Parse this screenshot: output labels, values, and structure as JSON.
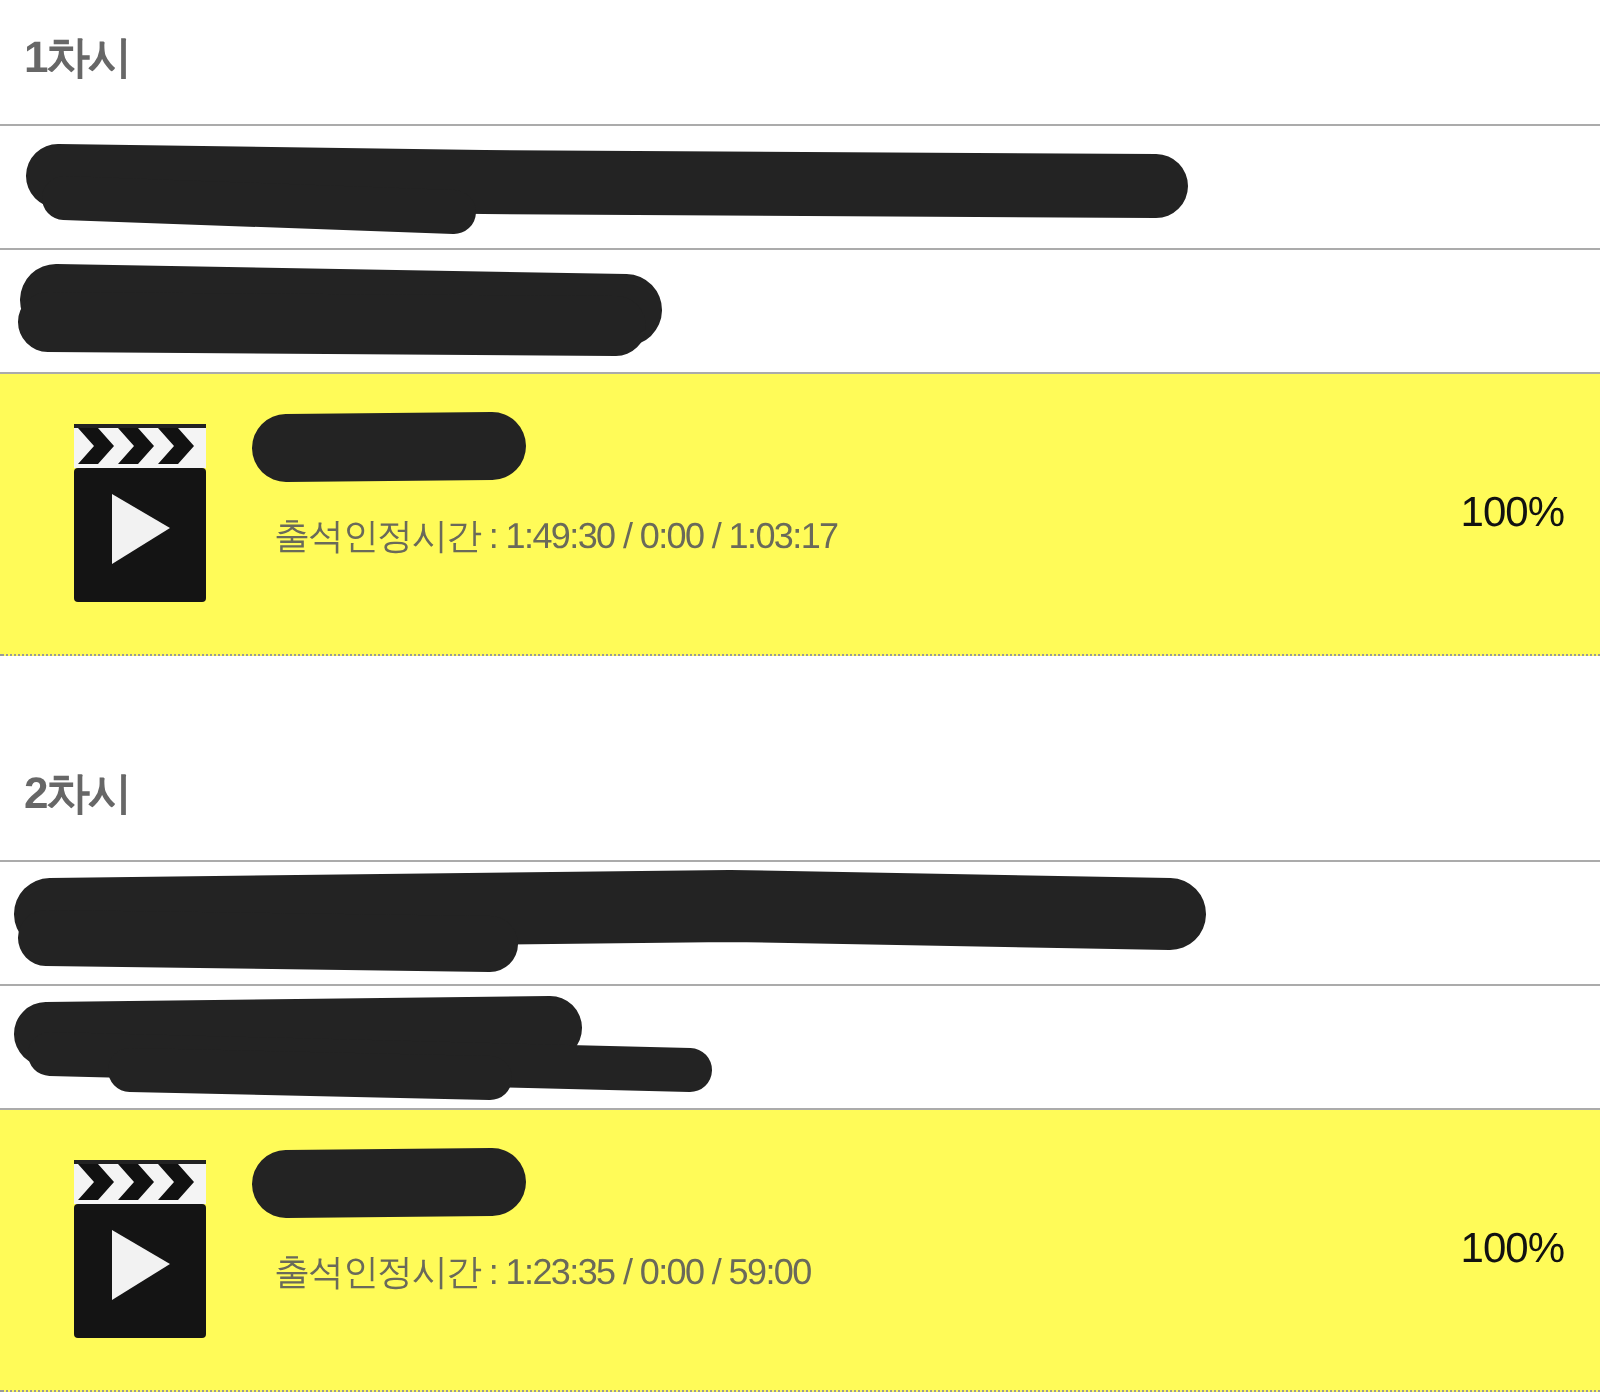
{
  "sessions": [
    {
      "title": "1차시",
      "rows": [
        {
          "kind": "redacted"
        },
        {
          "kind": "redacted"
        }
      ],
      "lecture": {
        "kind": "video",
        "highlighted": true,
        "title": {
          "kind": "redacted"
        },
        "attendance": "출석인정시간 : 1:49:30 / 0:00 / 1:03:17",
        "progress": "100%"
      }
    },
    {
      "title": "2차시",
      "rows": [
        {
          "kind": "redacted"
        },
        {
          "kind": "redacted"
        }
      ],
      "lecture": {
        "kind": "video",
        "highlighted": true,
        "title": {
          "kind": "redacted"
        },
        "attendance": "출석인정시간 : 1:23:35 / 0:00 / 59:00",
        "progress": "100%"
      }
    }
  ]
}
